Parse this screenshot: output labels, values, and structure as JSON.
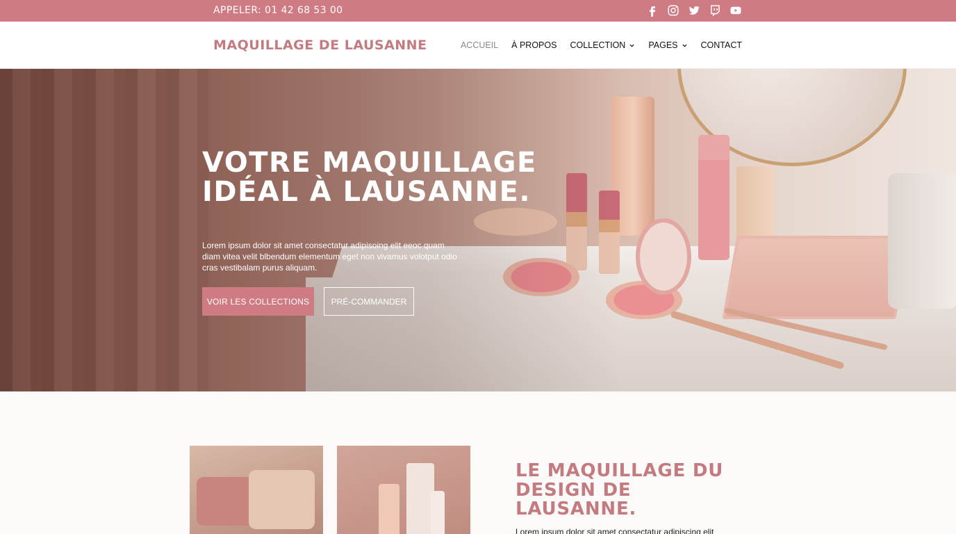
{
  "topbar": {
    "phone": "APPELER: 01 42 68 53 00",
    "social_icons": [
      "facebook-icon",
      "instagram-icon",
      "twitter-icon",
      "twitch-icon",
      "youtube-icon"
    ]
  },
  "header": {
    "logo": "MAQUILLAGE DE LAUSANNE",
    "nav": [
      {
        "label": "ACCUEIL",
        "active": true
      },
      {
        "label": "À PROPOS"
      },
      {
        "label": "COLLECTION",
        "dropdown": true
      },
      {
        "label": "PAGES",
        "dropdown": true
      },
      {
        "label": "CONTACT"
      }
    ]
  },
  "hero": {
    "title": "VOTRE MAQUILLAGE IDÉAL À LAUSANNE.",
    "text": "Lorem ipsum dolor sit amet consectatur adipisoing elit eeoc quam diam vitea velit blbendum elementum eget non vivamus volotput odio cras vestibalam purus aliquam.",
    "primary_button": "VOIR LES COLLECTIONS",
    "secondary_button": "PRÉ-COMMANDER"
  },
  "section": {
    "title": "LE MAQUILLAGE DU DESIGN DE LAUSANNE.",
    "text": "Lorem ipsum dolor sit amet consectatur adipiscing elit"
  },
  "colors": {
    "accent": "#cf7b83",
    "logo": "#c37b80",
    "background": "#fbfaf8"
  }
}
